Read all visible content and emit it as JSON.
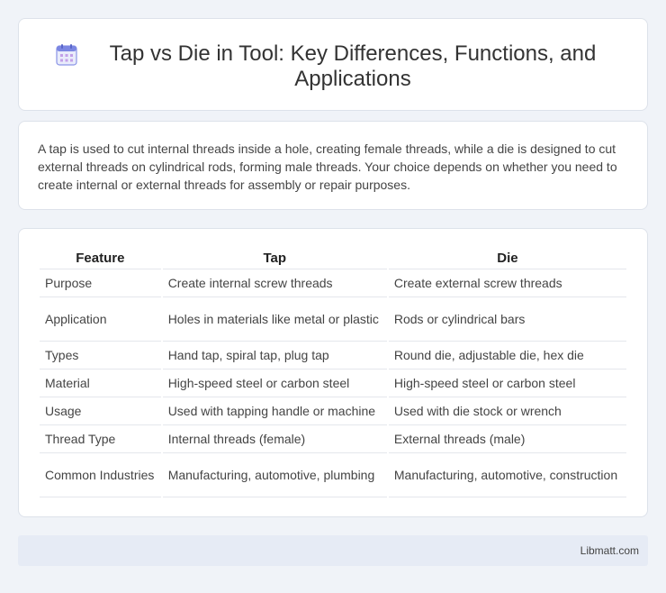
{
  "header": {
    "icon": "calendar-icon",
    "title": "Tap vs Die in Tool: Key Differences, Functions, and Applications"
  },
  "intro": "A tap is used to cut internal threads inside a hole, creating female threads, while a die is designed to cut external threads on cylindrical rods, forming male threads. Your choice depends on whether you need to create internal or external threads for assembly or repair purposes.",
  "table": {
    "headers": [
      "Feature",
      "Tap",
      "Die"
    ],
    "rows": [
      [
        "Purpose",
        "Create internal screw threads",
        "Create external screw threads"
      ],
      [
        "Application",
        "Holes in materials like metal or plastic",
        "Rods or cylindrical bars"
      ],
      [
        "Types",
        "Hand tap, spiral tap, plug tap",
        "Round die, adjustable die, hex die"
      ],
      [
        "Material",
        "High-speed steel or carbon steel",
        "High-speed steel or carbon steel"
      ],
      [
        "Usage",
        "Used with tapping handle or machine",
        "Used with die stock or wrench"
      ],
      [
        "Thread Type",
        "Internal threads (female)",
        "External threads (male)"
      ],
      [
        "Common Industries",
        "Manufacturing, automotive, plumbing",
        "Manufacturing, automotive, construction"
      ]
    ]
  },
  "footer": {
    "brand": "Libmatt.com"
  },
  "colors": {
    "page_bg": "#f0f3f8",
    "card_bg": "#ffffff",
    "footer_bg": "#e6ebf5",
    "icon_accent": "#6c7fe0"
  }
}
